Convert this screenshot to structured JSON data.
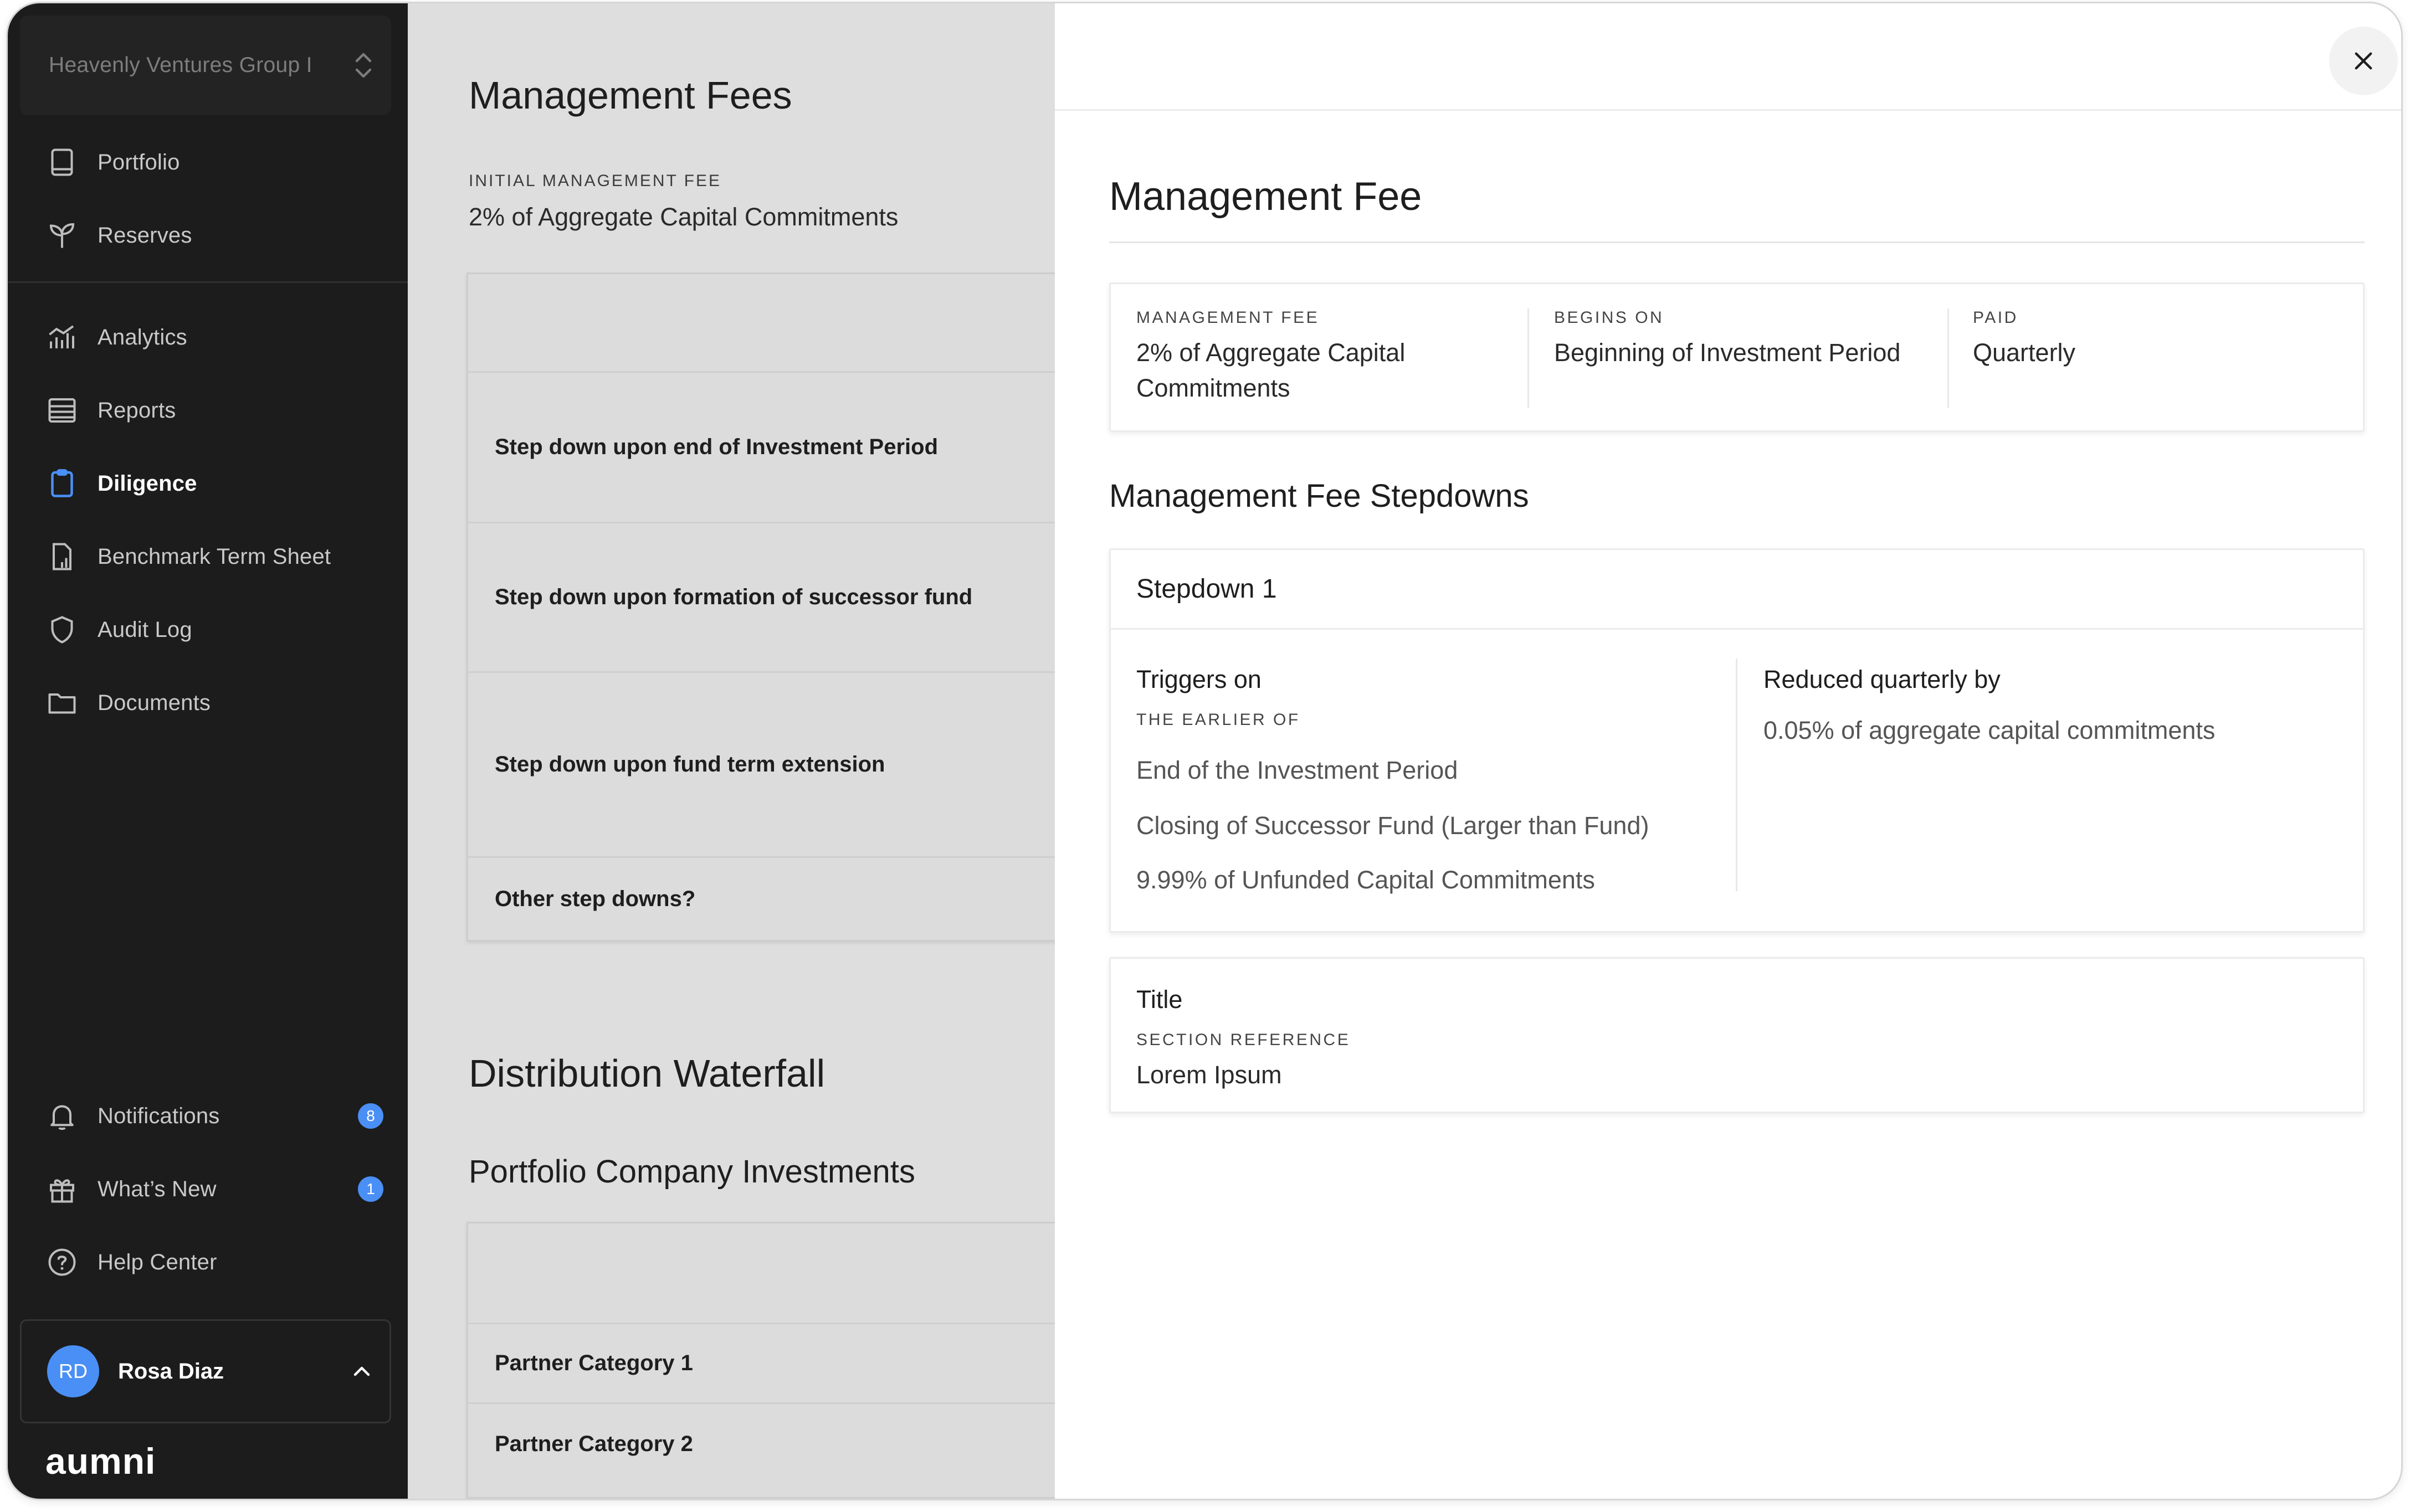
{
  "sidebar": {
    "org_name": "Heavenly Ventures Group I",
    "nav": [
      {
        "label": "Portfolio",
        "icon": "book-icon"
      },
      {
        "label": "Reserves",
        "icon": "sprout-icon"
      },
      {
        "label": "Analytics",
        "icon": "analytics-icon"
      },
      {
        "label": "Reports",
        "icon": "reports-icon"
      },
      {
        "label": "Diligence",
        "icon": "clipboard-icon",
        "active": true
      },
      {
        "label": "Benchmark Term Sheet",
        "icon": "term-sheet-icon"
      },
      {
        "label": "Audit Log",
        "icon": "shield-icon"
      },
      {
        "label": "Documents",
        "icon": "folder-icon"
      }
    ],
    "bottom_nav": [
      {
        "label": "Notifications",
        "icon": "bell-icon",
        "badge": "8"
      },
      {
        "label": "What’s New",
        "icon": "gift-icon",
        "badge": "1"
      },
      {
        "label": "Help Center",
        "icon": "help-circle-icon"
      }
    ],
    "user": {
      "initials": "RD",
      "name": "Rosa Diaz"
    },
    "logo": "aumni",
    "accent_color": "#4a8ff5"
  },
  "main": {
    "title": "Management Fees",
    "initial_fee_label": "INITIAL MANAGEMENT FEE",
    "initial_fee_value": "2% of Aggregate Capital Commitments",
    "stepdown_rows": [
      "Step down upon end of Investment Period",
      "Step down upon formation of successor fund",
      "Step down upon fund term extension",
      "Other step downs?"
    ],
    "waterfall_title": "Distribution Waterfall",
    "investments_title": "Portfolio Company Investments",
    "partner_rows": [
      "Partner Category 1",
      "Partner Category 2"
    ]
  },
  "panel": {
    "title": "Management Fee",
    "fee_card": {
      "management_fee_label": "MANAGEMENT FEE",
      "management_fee_line1": "2% of Aggregate Capital",
      "management_fee_line2": "Commitments",
      "begins_on_label": "BEGINS ON",
      "begins_on_value": "Beginning of Investment Period",
      "paid_label": "PAID",
      "paid_value": "Quarterly"
    },
    "stepdowns_title": "Management Fee Stepdowns",
    "stepdown": {
      "title": "Stepdown 1",
      "triggers_title": "Triggers on",
      "triggers_label": "THE EARLIER OF",
      "triggers": [
        "End of the Investment Period",
        "Closing of Successor Fund (Larger than Fund)",
        "9.99% of Unfunded Capital Commitments"
      ],
      "reduced_title": "Reduced quarterly by",
      "reduced_value": "0.05% of aggregate capital commitments"
    },
    "reference_card": {
      "title": "Title",
      "label": "SECTION REFERENCE",
      "value": "Lorem Ipsum"
    }
  }
}
